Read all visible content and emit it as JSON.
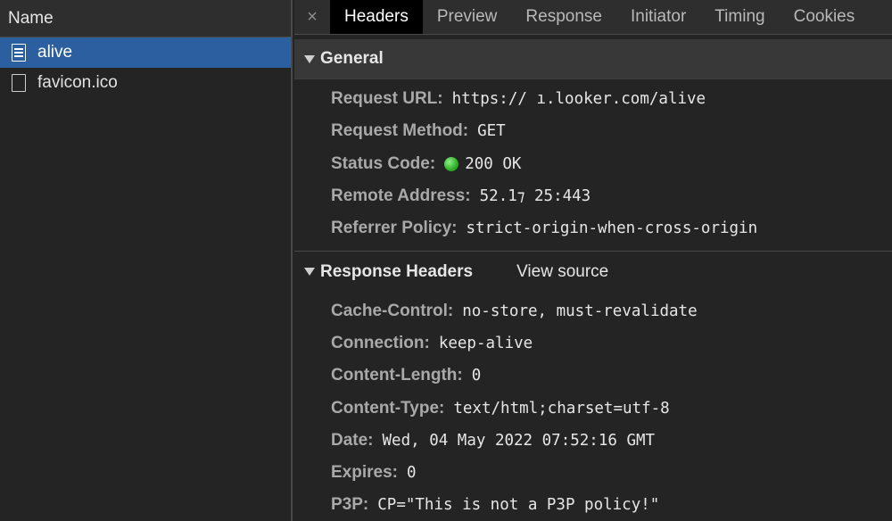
{
  "list": {
    "header": "Name",
    "items": [
      {
        "name": "alive",
        "icon": "document-icon",
        "selected": true
      },
      {
        "name": "favicon.ico",
        "icon": "blank-file-icon",
        "selected": false
      }
    ]
  },
  "tabs": {
    "close": "×",
    "items": [
      "Headers",
      "Preview",
      "Response",
      "Initiator",
      "Timing",
      "Cookies"
    ],
    "active": "Headers"
  },
  "general": {
    "title": "General",
    "rows": [
      {
        "key": "Request URL:",
        "value": "https://          ı.looker.com/alive"
      },
      {
        "key": "Request Method:",
        "value": "GET"
      },
      {
        "key": "Status Code:",
        "value": "200 OK"
      },
      {
        "key": "Remote Address:",
        "value": "52.1⁊       25:443"
      },
      {
        "key": "Referrer Policy:",
        "value": "strict-origin-when-cross-origin"
      }
    ]
  },
  "response_headers": {
    "title": "Response Headers",
    "view_source": "View source",
    "rows": [
      {
        "key": "Cache-Control:",
        "value": "no-store, must-revalidate"
      },
      {
        "key": "Connection:",
        "value": "keep-alive"
      },
      {
        "key": "Content-Length:",
        "value": "0"
      },
      {
        "key": "Content-Type:",
        "value": "text/html;charset=utf-8"
      },
      {
        "key": "Date:",
        "value": "Wed, 04 May 2022 07:52:16 GMT"
      },
      {
        "key": "Expires:",
        "value": "0"
      },
      {
        "key": "P3P:",
        "value": "CP=\"This is not a P3P policy!\""
      }
    ]
  },
  "colors": {
    "selected_row": "#2b5fa0",
    "status_ok": "#3cc234"
  }
}
